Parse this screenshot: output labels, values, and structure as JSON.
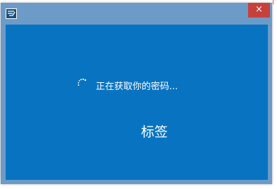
{
  "window": {
    "title_icon": "app-icon",
    "close_glyph": "×",
    "close_color": "#c7413c",
    "frame_color": "#6c9bc7",
    "client_color": "#0874c1"
  },
  "content": {
    "spinner_icon": "loading-spinner-icon",
    "status": "正在获取你的密码...",
    "label": "标签"
  }
}
